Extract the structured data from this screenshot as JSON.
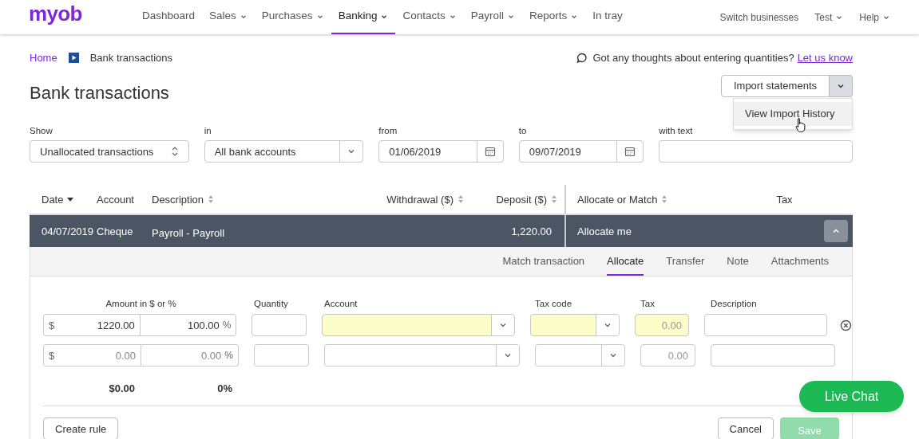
{
  "nav": {
    "logo": "myob",
    "items": [
      {
        "label": "Dashboard",
        "dropdown": false,
        "selected": false
      },
      {
        "label": "Sales",
        "dropdown": true,
        "selected": false
      },
      {
        "label": "Purchases",
        "dropdown": true,
        "selected": false
      },
      {
        "label": "Banking",
        "dropdown": true,
        "selected": true
      },
      {
        "label": "Contacts",
        "dropdown": true,
        "selected": false
      },
      {
        "label": "Payroll",
        "dropdown": true,
        "selected": false
      },
      {
        "label": "Reports",
        "dropdown": true,
        "selected": false
      },
      {
        "label": "In tray",
        "dropdown": false,
        "selected": false
      }
    ],
    "right": [
      {
        "label": "Switch businesses",
        "dropdown": false
      },
      {
        "label": "Test",
        "dropdown": true
      },
      {
        "label": "Help",
        "dropdown": true
      }
    ]
  },
  "breadcrumb": {
    "home": "Home",
    "current": "Bank transactions"
  },
  "feedback": {
    "text": "Got any thoughts about entering quantities?",
    "link": "Let us know"
  },
  "title": "Bank transactions",
  "import": {
    "label": "Import statements",
    "menu_open": true,
    "menu": [
      "View Import History"
    ]
  },
  "filters": [
    {
      "label": "Show",
      "kind": "select",
      "value": "Unallocated transactions"
    },
    {
      "label": "in",
      "kind": "dropdown",
      "value": "All bank accounts"
    },
    {
      "label": "from",
      "kind": "date",
      "value": "01/06/2019"
    },
    {
      "label": "to",
      "kind": "date",
      "value": "09/07/2019"
    },
    {
      "label": "with text",
      "kind": "text"
    }
  ],
  "table": {
    "columns": [
      {
        "label": "Date",
        "sorted": true,
        "sortable": true
      },
      {
        "label": "Account",
        "sorted": false,
        "sortable": false
      },
      {
        "label": "Description",
        "sorted": false,
        "sortable": true
      },
      {
        "label": "Withdrawal ($)",
        "sorted": false,
        "sortable": true
      },
      {
        "label": "Deposit ($)",
        "sorted": false,
        "sortable": true
      },
      {
        "label": "Allocate or Match",
        "sorted": false,
        "sortable": true
      },
      {
        "label": "Tax",
        "sorted": false,
        "sortable": false
      }
    ],
    "row": {
      "date": "04/07/2019",
      "account": "Cheque",
      "description": "Payroll - Payroll",
      "deposit": "1,220.00",
      "allocate": "Allocate me",
      "expanded": true
    }
  },
  "panel_tabs": [
    {
      "label": "Match transaction",
      "selected": false
    },
    {
      "label": "Allocate",
      "selected": true
    },
    {
      "label": "Transfer",
      "selected": false
    },
    {
      "label": "Note",
      "selected": false
    },
    {
      "label": "Attachments",
      "selected": false
    }
  ],
  "allocation": {
    "headers": [
      "Amount in $ or %",
      "Quantity",
      "Account",
      "Tax code",
      "Tax",
      "Description"
    ],
    "currency": "$",
    "percent": "%",
    "lines": [
      {
        "amount": "1220.00",
        "percent_value": "100.00",
        "tax": "0.00",
        "highlighted": true,
        "removable": true
      },
      {
        "amount": "0.00",
        "percent_value": "0.00",
        "tax": "0.00",
        "highlighted": false,
        "removable": false
      }
    ],
    "total_amount": "$0.00",
    "total_percent": "0%"
  },
  "buttons": {
    "create_rule": "Create rule",
    "cancel": "Cancel",
    "save": "Save"
  },
  "chat": "Live Chat"
}
